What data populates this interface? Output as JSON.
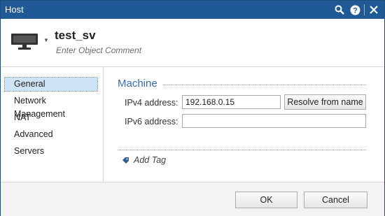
{
  "window": {
    "title": "Host"
  },
  "header": {
    "object_name": "test_sv",
    "comment_placeholder": "Enter Object Comment"
  },
  "sidebar": {
    "items": [
      {
        "label": "General",
        "selected": true
      },
      {
        "label": "Network Management"
      },
      {
        "label": "NAT"
      },
      {
        "label": "Advanced"
      },
      {
        "label": "Servers"
      }
    ]
  },
  "main": {
    "section_title": "Machine",
    "ipv4_label": "IPv4 address:",
    "ipv4_value": "192.168.0.15",
    "resolve_button": "Resolve from name",
    "ipv6_label": "IPv6 address:",
    "ipv6_value": "",
    "add_tag": "Add Tag"
  },
  "footer": {
    "ok": "OK",
    "cancel": "Cancel"
  },
  "colors": {
    "titlebar": "#1f5a96",
    "accent": "#3a6ea8",
    "selection": "#cfe3f7"
  }
}
